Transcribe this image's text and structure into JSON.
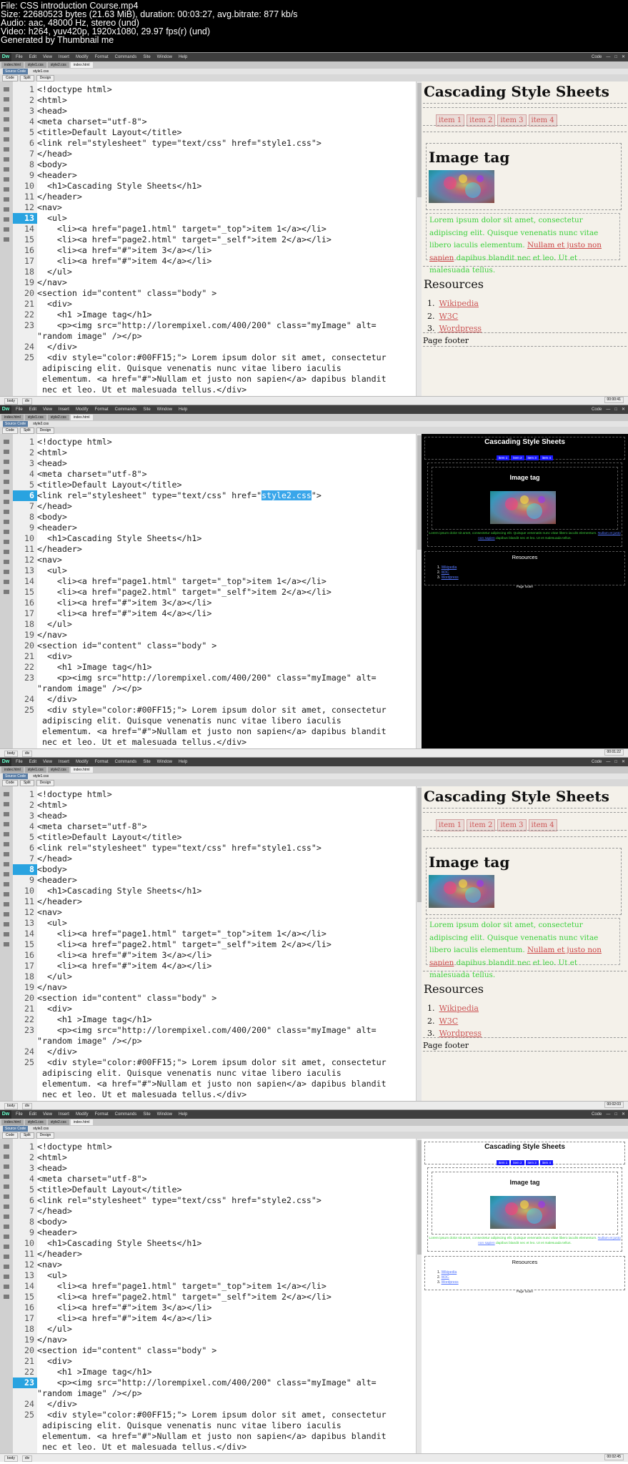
{
  "header": {
    "lines": [
      "File: CSS introduction Course.mp4",
      "Size: 22680523 bytes (21.63 MiB), duration: 00:03:27, avg.bitrate: 877 kb/s",
      "Audio: aac, 48000 Hz, stereo (und)",
      "Video: h264, yuv420p, 1920x1080, 29.97 fps(r) (und)",
      "Generated by Thumbnail me"
    ]
  },
  "app": {
    "logo": "Dw",
    "menu": [
      "File",
      "Edit",
      "View",
      "Insert",
      "Modify",
      "Format",
      "Commands",
      "Site",
      "Window",
      "Help"
    ],
    "workspace": "Code",
    "tabs": [
      "index.html",
      "style1.css",
      "style2.css",
      "index.html"
    ],
    "related_source": "Source Code",
    "views": [
      "Code",
      "Split",
      "Design"
    ],
    "status": [
      "body",
      "div"
    ]
  },
  "code_lines": [
    "<!doctype html>",
    "<html>",
    "<head>",
    "<meta charset=\"utf-8\">",
    "<title>Default Layout</title>",
    "<link rel=\"stylesheet\" type=\"text/css\" href=\"style1.css\">",
    "</head>",
    "<body>",
    "<header>",
    "  <h1>Cascading Style Sheets</h1>",
    "</header>",
    "<nav>",
    "  <ul>",
    "    <li><a href=\"page1.html\" target=\"_top\">item 1</a></li>",
    "    <li><a href=\"page2.html\" target=\"_self\">item 2</a></li>",
    "    <li><a href=\"#\">item 3</a></li>",
    "    <li><a href=\"#\">item 4</a></li>",
    "  </ul>",
    "</nav>",
    "<section id=\"content\" class=\"body\" >",
    "  <div>",
    "    <h1 >Image tag</h1>",
    "    <p><img src=\"http://lorempixel.com/400/200\" class=\"myImage\" alt=",
    "\"random image\" /></p>",
    "  </div>",
    "  <div style=\"color:#00FF15;\"> Lorem ipsum dolor sit amet, consectetur",
    " adipiscing elit. Quisque venenatis nunc vitae libero iaculis",
    " elementum. <a href=\"#\">Nullam et justo non sapien</a> dapibus blandit",
    " nec et leo. Ut et malesuada tellus.</div>"
  ],
  "line_numbers": [
    "1",
    "2",
    "3",
    "4",
    "5",
    "6",
    "7",
    "8",
    "9",
    "10",
    "11",
    "12",
    "13",
    "14",
    "15",
    "16",
    "17",
    "18",
    "19",
    "20",
    "21",
    "22",
    "23",
    "",
    "24",
    "25"
  ],
  "link_prefix": "<link rel=\"stylesheet\" type=\"text/css\" href=\"",
  "link_suffix": "\">",
  "stylesheet_1": "style1.css",
  "stylesheet_2": "style2.css",
  "line_23_head": "    <p>",
  "line_23_tail": "<img src=\"http://lorempixel.com/400/200\" class=\"myImage\" alt=",
  "line_23_cont": "\"random image\" /></p>",
  "line_8_head": "<body",
  "line_8_tail": ">",
  "preview": {
    "title": "Cascading Style Sheets",
    "nav": [
      "item 1",
      "item 2",
      "item 3",
      "item 4"
    ],
    "image_heading": "Image tag",
    "text_1": "Lorem ipsum dolor sit amet, consectetur adipiscing elit. Quisque venenatis nunc vitae libero iaculis elementum.",
    "text_link": "Nullam et justo non sapien",
    "text_2": "dapibus blandit nec et leo. Ut et malesuada tellus.",
    "resources": "Resources",
    "links": [
      "Wikipedia",
      "W3C",
      "Wordpress"
    ],
    "footer": "Page footer"
  },
  "frames": [
    {
      "timestamp": "00:00:41",
      "active_line": "13",
      "stylesheet": "style1.css",
      "theme": "light"
    },
    {
      "timestamp": "00:01:22",
      "active_line": "6",
      "stylesheet": "style2.css",
      "theme": "dark"
    },
    {
      "timestamp": "00:02:03",
      "active_line": "8",
      "stylesheet": "style1.css",
      "theme": "light"
    },
    {
      "timestamp": "00:02:45",
      "active_line": "23",
      "stylesheet": "style2.css",
      "theme": "white"
    }
  ],
  "colors": {
    "green_text": "#3dd13d",
    "link_red": "#cc5555",
    "nav_blue": "#1a1aff",
    "line_highlight": "#29a3e0"
  }
}
